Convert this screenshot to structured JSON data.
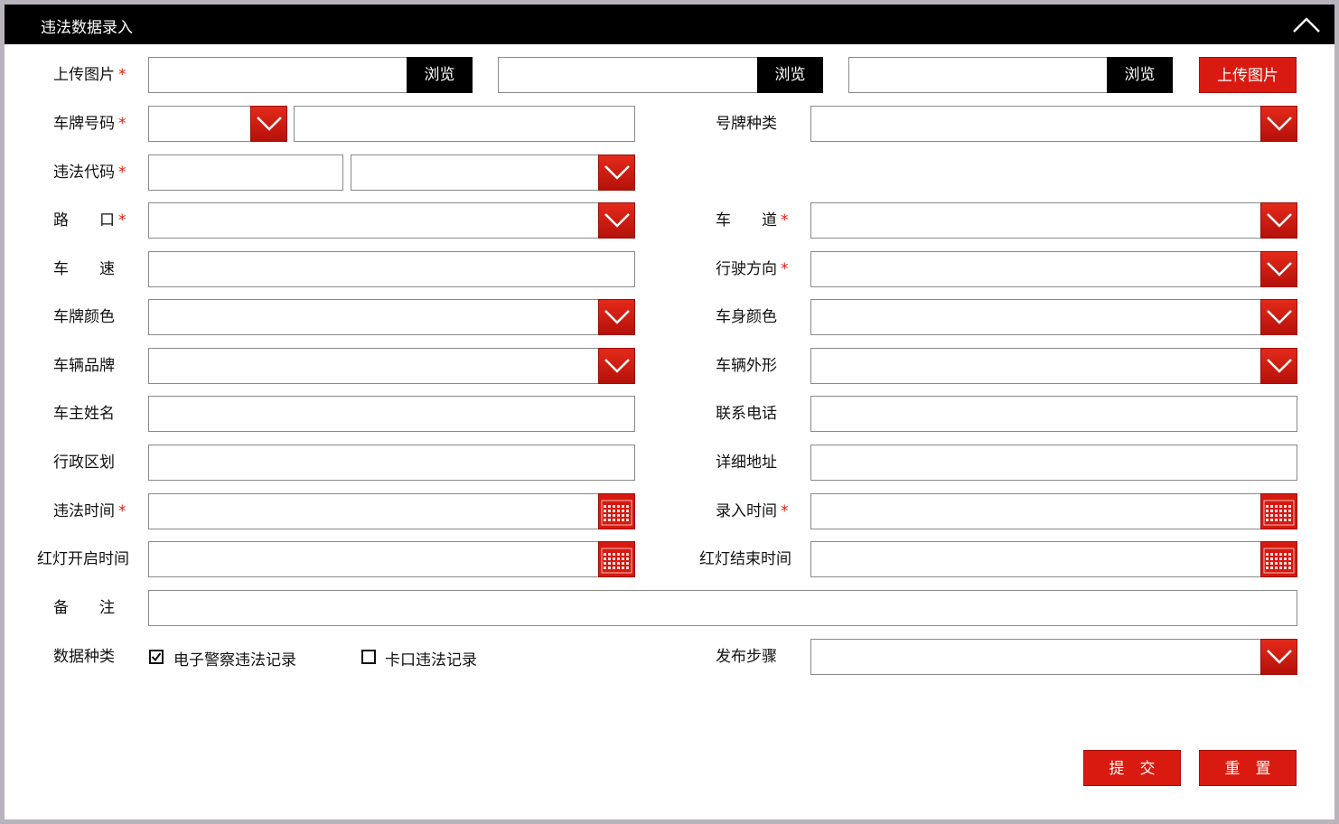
{
  "header": {
    "title": "违法数据录入",
    "collapse_icon": "chevron-up-icon"
  },
  "upload": {
    "label": "上传图片",
    "browse_label": "浏览",
    "upload_button": "上传图片"
  },
  "fields": {
    "plate_number": "车牌号码",
    "plate_type": "号牌种类",
    "violation_code": "违法代码",
    "crossing": "路　　口",
    "lane": "车　　道",
    "speed": "车　　速",
    "direction": "行驶方向",
    "plate_color": "车牌颜色",
    "body_color": "车身颜色",
    "brand": "车辆品牌",
    "vehicle_shape": "车辆外形",
    "owner_name": "车主姓名",
    "phone": "联系电话",
    "district": "行政区划",
    "address": "详细地址",
    "violation_time": "违法时间",
    "entry_time": "录入时间",
    "red_start": "红灯开启时间",
    "red_end": "红灯结束时间",
    "remarks": "备　　注",
    "data_type": "数据种类",
    "publish_step": "发布步骤"
  },
  "required_mark": "*",
  "data_type_options": [
    {
      "label": "电子警察违法记录",
      "checked": true
    },
    {
      "label": "卡口违法记录",
      "checked": false
    }
  ],
  "actions": {
    "submit": "提　交",
    "reset": "重　置"
  },
  "colors": {
    "accent": "#d91a10",
    "header_bg": "#000000",
    "required": "#e01b10"
  }
}
